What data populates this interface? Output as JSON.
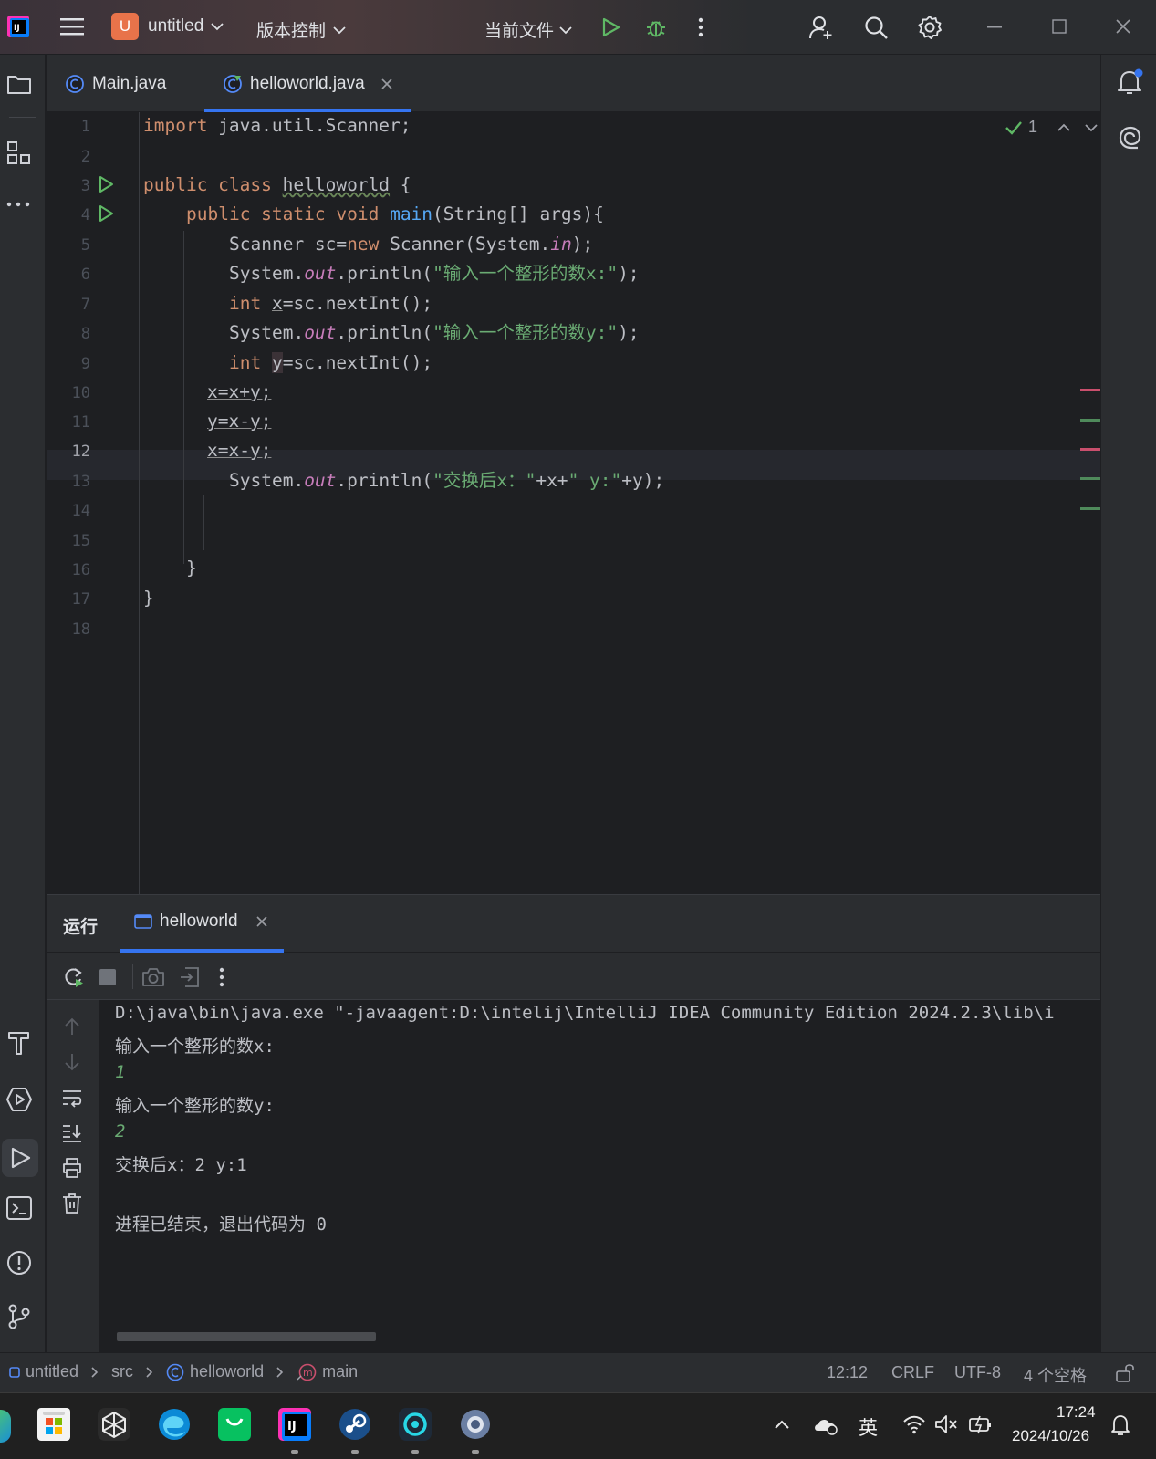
{
  "titlebar": {
    "project_badge": "U",
    "project_name": "untitled",
    "vcs": "版本控制",
    "run_config": "当前文件"
  },
  "tabs": [
    {
      "label": "Main.java"
    },
    {
      "label": "helloworld.java"
    }
  ],
  "inspection": {
    "count": "1"
  },
  "line_numbers": [
    "1",
    "2",
    "3",
    "4",
    "5",
    "6",
    "7",
    "8",
    "9",
    "10",
    "11",
    "12",
    "13",
    "14",
    "15",
    "16",
    "17",
    "18"
  ],
  "code": {
    "l1_kw": "import",
    "l1_rest": " java.util.Scanner;",
    "l3_kw": "public class",
    "l3_name": "helloworld",
    "l3_rest": " {",
    "l4_kw": "public static void",
    "l4_fn": "main",
    "l4_rest": "(String[] args){",
    "l5_a": "Scanner sc=",
    "l5_kw": "new",
    "l5_b": " Scanner(System.",
    "l5_fld": "in",
    "l5_c": ");",
    "l6_a": "System.",
    "l6_fld": "out",
    "l6_b": ".println(",
    "l6_str": "\"输入一个整形的数x:\"",
    "l6_c": ");",
    "l7_kw": "int",
    "l7_var": "x",
    "l7_rest": "=sc.nextInt();",
    "l8_a": "System.",
    "l8_fld": "out",
    "l8_b": ".println(",
    "l8_str": "\"输入一个整形的数y:\"",
    "l8_c": ");",
    "l9_kw": "int",
    "l9_var": "y",
    "l9_rest": "=sc.nextInt();",
    "l10": "x=x+y;",
    "l11": "y=x-y;",
    "l12": "x=x-y;",
    "l13_a": "System.",
    "l13_fld": "out",
    "l13_b": ".println(",
    "l13_str1": "\"交换后x：\"",
    "l13_c": "+x+",
    "l13_str2": "\" y:\"",
    "l13_d": "+y);",
    "l16": "}",
    "l17": "}"
  },
  "run": {
    "title": "运行",
    "tab": "helloworld",
    "output": [
      "D:\\java\\bin\\java.exe \"-javaagent:D:\\intelij\\IntelliJ IDEA Community Edition 2024.2.3\\lib\\i",
      "输入一个整形的数x:",
      "1",
      "输入一个整形的数y:",
      "2",
      "交换后x：2 y:1",
      "",
      "进程已结束，退出代码为 0"
    ]
  },
  "statusbar": {
    "project": "untitled",
    "src": "src",
    "class": "helloworld",
    "method": "main",
    "position": "12:12",
    "line_sep": "CRLF",
    "encoding": "UTF-8",
    "indent": "4 个空格"
  },
  "taskbar": {
    "ime": "英",
    "time": "17:24",
    "date": "2024/10/26"
  },
  "colors": {
    "accent": "#3574f0",
    "keyword": "#cf8e6d",
    "string": "#6aab73",
    "function": "#56a8f5"
  }
}
